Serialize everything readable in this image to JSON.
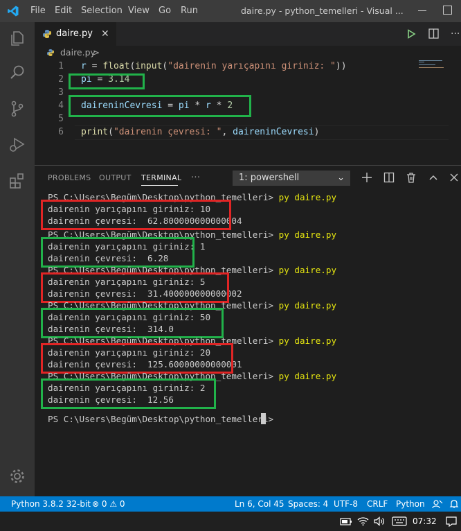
{
  "titlebar": {
    "menu": [
      "File",
      "Edit",
      "Selection",
      "View",
      "Go",
      "Run"
    ],
    "window_title": "daire.py - python_temelleri - Visual ..."
  },
  "tab": {
    "label": "daire.py",
    "close": "✕"
  },
  "breadcrumb": {
    "file": "daire.py",
    "chevron": ">"
  },
  "editor": {
    "line_numbers": [
      "1",
      "2",
      "3",
      "4",
      "5",
      "6"
    ],
    "lines": [
      "r = float(input(\"dairenin yarıçapını giriniz: \"))",
      "pi = 3.14",
      "",
      "daireninCevresi = pi * r * 2",
      "",
      "print(\"dairenin çevresi: \", daireninCevresi)"
    ]
  },
  "panel": {
    "tabs": [
      "PROBLEMS",
      "OUTPUT",
      "TERMINAL",
      "···"
    ],
    "active_tab": "TERMINAL",
    "terminal_select": "1: powershell"
  },
  "terminal": {
    "prompt": "PS C:\\Users\\Begüm\\Desktop\\python_temelleri> ",
    "command": "py daire.py",
    "runs": [
      {
        "input": "dairenin yarıçapını giriniz: 10",
        "output": "dairenin çevresi:  62.800000000000004"
      },
      {
        "input": "dairenin yarıçapını giriniz: 1",
        "output": "dairenin çevresi:  6.28"
      },
      {
        "input": "dairenin yarıçapını giriniz: 5",
        "output": "dairenin çevresi:  31.400000000000002"
      },
      {
        "input": "dairenin yarıçapını giriniz: 50",
        "output": "dairenin çevresi:  314.0"
      },
      {
        "input": "dairenin yarıçapını giriniz: 20",
        "output": "dairenin çevresi:  125.60000000000001"
      },
      {
        "input": "dairenin yarıçapını giriniz: 2",
        "output": "dairenin çevresi:  12.56"
      }
    ],
    "final_prompt": "PS C:\\Users\\Begüm\\Desktop\\python_temelleri> "
  },
  "statusbar": {
    "interpreter": "Python 3.8.2 32-bit",
    "problems": "⊗ 0 ⚠ 0",
    "position": "Ln 6, Col 45",
    "spaces": "Spaces: 4",
    "encoding": "UTF-8",
    "eol": "CRLF",
    "language": "Python"
  },
  "taskbar": {
    "time": "07:32"
  },
  "colors": {
    "accent": "#007acc",
    "highlight_green": "#21b24a",
    "highlight_red": "#e02525"
  }
}
